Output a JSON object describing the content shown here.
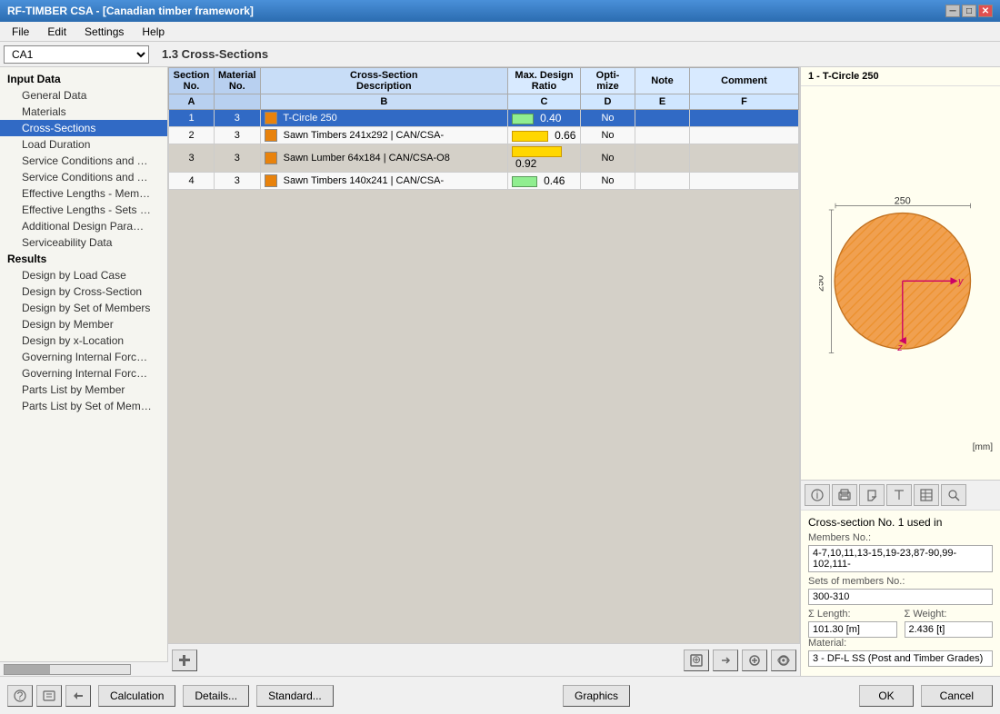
{
  "titleBar": {
    "title": "RF-TIMBER CSA - [Canadian timber framework]",
    "controls": [
      "minimize",
      "maximize",
      "close"
    ]
  },
  "menuBar": {
    "items": [
      "File",
      "Edit",
      "Settings",
      "Help"
    ]
  },
  "toolbar": {
    "dropdown": "CA1",
    "sectionTitle": "1.3 Cross-Sections"
  },
  "leftPanel": {
    "sections": [
      {
        "label": "Input Data",
        "items": [
          {
            "label": "General Data",
            "indent": 1,
            "active": false
          },
          {
            "label": "Materials",
            "indent": 1,
            "active": false
          },
          {
            "label": "Cross-Sections",
            "indent": 1,
            "active": true
          },
          {
            "label": "Load Duration",
            "indent": 1,
            "active": false
          },
          {
            "label": "Service Conditions and Treatme...",
            "indent": 1,
            "active": false
          },
          {
            "label": "Service Conditions and Treatme...",
            "indent": 1,
            "active": false
          },
          {
            "label": "Effective Lengths - Members",
            "indent": 1,
            "active": false
          },
          {
            "label": "Effective Lengths - Sets of Me...",
            "indent": 1,
            "active": false
          },
          {
            "label": "Additional Design Parameters",
            "indent": 1,
            "active": false
          },
          {
            "label": "Serviceability Data",
            "indent": 1,
            "active": false
          }
        ]
      },
      {
        "label": "Results",
        "items": [
          {
            "label": "Design by Load Case",
            "indent": 1,
            "active": false
          },
          {
            "label": "Design by Cross-Section",
            "indent": 1,
            "active": false
          },
          {
            "label": "Design by Set of Members",
            "indent": 1,
            "active": false
          },
          {
            "label": "Design by Member",
            "indent": 1,
            "active": false
          },
          {
            "label": "Design by x-Location",
            "indent": 1,
            "active": false
          },
          {
            "label": "Governing Internal Forces by M...",
            "indent": 1,
            "active": false
          },
          {
            "label": "Governing Internal Forces by S...",
            "indent": 1,
            "active": false
          },
          {
            "label": "Parts List by Member",
            "indent": 1,
            "active": false
          },
          {
            "label": "Parts List by Set of Members",
            "indent": 1,
            "active": false
          }
        ]
      }
    ]
  },
  "table": {
    "headers": {
      "colA": "A",
      "colB": "B",
      "colC": "C",
      "colD": "D",
      "colE": "E",
      "colF": "F",
      "sectionNo": "Section No.",
      "materialNo": "Material No.",
      "crossSectionDesc": "Cross-Section Description",
      "maxDesignRatio": "Max. Design Ratio",
      "optimize": "Opti-mize",
      "note": "Note",
      "comment": "Comment"
    },
    "rows": [
      {
        "no": 1,
        "materialNo": 3,
        "color": "#E8820C",
        "description": "T-Circle 250",
        "designRatio": 0.4,
        "ratioType": "green",
        "optimize": "No",
        "note": "",
        "comment": "",
        "selected": true
      },
      {
        "no": 2,
        "materialNo": 3,
        "color": "#E8820C",
        "description": "Sawn Timbers 241x292 | CAN/CSA-",
        "designRatio": 0.66,
        "ratioType": "yellow",
        "optimize": "No",
        "note": "",
        "comment": "",
        "selected": false
      },
      {
        "no": 3,
        "materialNo": 3,
        "color": "#E8820C",
        "description": "Sawn Lumber 64x184 | CAN/CSA-O8",
        "designRatio": 0.92,
        "ratioType": "yellow",
        "optimize": "No",
        "note": "",
        "comment": "",
        "selected": false
      },
      {
        "no": 4,
        "materialNo": 3,
        "color": "#E8820C",
        "description": "Sawn Timbers 140x241 | CAN/CSA-",
        "designRatio": 0.46,
        "ratioType": "green",
        "optimize": "No",
        "note": "",
        "comment": "",
        "selected": false
      }
    ]
  },
  "crossSectionPanel": {
    "title": "1 - T-Circle 250",
    "unitLabel": "[mm]",
    "toolbarButtons": [
      "info",
      "print",
      "export",
      "text",
      "table",
      "zoom"
    ],
    "infoLabel": "Cross-section No. 1 used in",
    "membersLabel": "Members No.:",
    "membersValue": "4-7,10,11,13-15,19-23,87-90,99-102,111-",
    "setsLabel": "Sets of members No.:",
    "setsValue": "300-310",
    "sumLengthLabel": "Σ Length:",
    "sumLengthValue": "101.30 [m]",
    "sumWeightLabel": "Σ Weight:",
    "sumWeightValue": "2.436 [t]",
    "materialLabel": "Material:",
    "materialValue": "3 - DF-L SS (Post and Timber Grades)"
  },
  "bottomBar": {
    "calculationLabel": "Calculation",
    "detailsLabel": "Details...",
    "standardLabel": "Standard...",
    "graphicsLabel": "Graphics",
    "okLabel": "OK",
    "cancelLabel": "Cancel"
  },
  "tableBottomIcons": [
    "add",
    "delete",
    "import",
    "export",
    "zoom-in",
    "zoom-out"
  ]
}
